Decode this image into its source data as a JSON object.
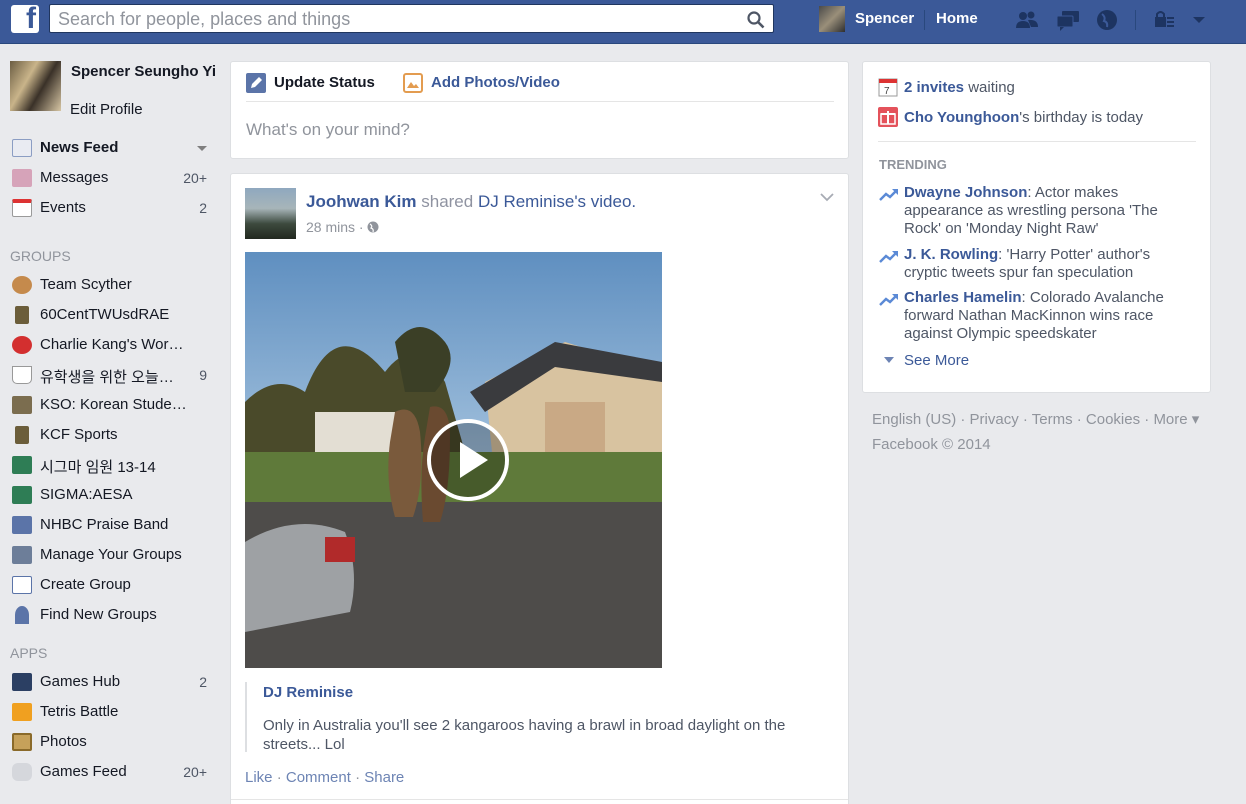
{
  "topbar": {
    "logo": "f",
    "search_placeholder": "Search for people, places and things",
    "user_name": "Spencer",
    "home_label": "Home"
  },
  "profile": {
    "name": "Spencer Seungho Yi",
    "edit": "Edit Profile"
  },
  "nav": [
    {
      "label": "News Feed",
      "count": ""
    },
    {
      "label": "Messages",
      "count": "20+"
    },
    {
      "label": "Events",
      "count": "2"
    }
  ],
  "groups_head": "GROUPS",
  "groups": [
    {
      "label": "Team Scyther",
      "count": ""
    },
    {
      "label": "60CentTWUsdRAE",
      "count": ""
    },
    {
      "label": "Charlie Kang's Wor…",
      "count": ""
    },
    {
      "label": "유학생을 위한 오늘…",
      "count": "9"
    },
    {
      "label": "KSO: Korean Stude…",
      "count": ""
    },
    {
      "label": "KCF Sports",
      "count": ""
    },
    {
      "label": "시그마 임원 13-14",
      "count": ""
    },
    {
      "label": "SIGMA:AESA",
      "count": ""
    },
    {
      "label": "NHBC Praise Band",
      "count": ""
    },
    {
      "label": "Manage Your Groups",
      "count": ""
    },
    {
      "label": "Create Group",
      "count": ""
    },
    {
      "label": "Find New Groups",
      "count": ""
    }
  ],
  "apps_head": "APPS",
  "apps": [
    {
      "label": "Games Hub",
      "count": "2"
    },
    {
      "label": "Tetris Battle",
      "count": ""
    },
    {
      "label": "Photos",
      "count": ""
    },
    {
      "label": "Games Feed",
      "count": "20+"
    }
  ],
  "composer": {
    "tab1": "Update Status",
    "tab2": "Add Photos/Video",
    "placeholder": "What's on your mind?"
  },
  "post": {
    "author": "Joohwan Kim",
    "shared": " shared ",
    "page": "DJ Reminise",
    "suffix": "'s video.",
    "time": "28 mins",
    "share_title": "DJ Reminise",
    "share_text": "Only in Australia you'll see 2 kangaroos having a brawl in broad daylight on the streets... Lol",
    "like": "Like",
    "comment": "Comment",
    "share": "Share"
  },
  "right": {
    "invites_count": "2 invites",
    "invites_rest": " waiting",
    "birthday_name": "Cho Younghoon",
    "birthday_rest": "'s birthday is today",
    "trending_head": "TRENDING",
    "trends": [
      {
        "name": "Dwayne Johnson",
        "text": ": Actor makes appearance as wrestling persona 'The Rock' on 'Monday Night Raw'"
      },
      {
        "name": "J. K. Rowling",
        "text": ": 'Harry Potter' author's cryptic tweets spur fan speculation"
      },
      {
        "name": "Charles Hamelin",
        "text": ": Colorado Avalanche forward Nathan MacKinnon wins race against Olympic speedskater"
      }
    ],
    "see_more": "See More"
  },
  "footer": {
    "line1": "English (US) · Privacy · Terms · Cookies · More ▾",
    "line2": "Facebook © 2014"
  },
  "colors": {
    "brand": "#3b5998",
    "background": "#e9eaed"
  }
}
